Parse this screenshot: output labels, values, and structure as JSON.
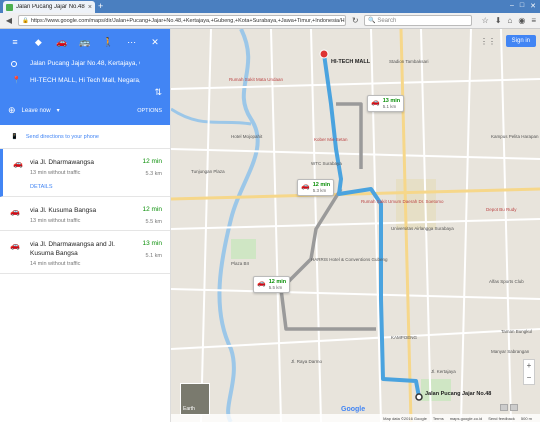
{
  "browser": {
    "tab_title": "Jalan Pucang Jajar No.48 to...",
    "url": "https://www.google.com/maps/dir/Jalan+Pucang+Jajar+No.48,+Kertajaya,+Gubeng,+Kota+Surabaya,+Jawa+Timur,+Indonesia/Hi-Te",
    "search_placeholder": "Search"
  },
  "panel": {
    "origin": "Jalan Pucang Jajar No.48, Kertajaya, G...",
    "destination": "HI-TECH MALL, Hi Tech Mall, Negara, K...",
    "leave_now": "Leave now",
    "options": "OPTIONS",
    "send_directions": "Send directions to your phone",
    "routes": [
      {
        "name": "via Jl. Dharmawangsa",
        "sub": "13 min without traffic",
        "time": "12 min",
        "dist": "5.3 km",
        "details": "DETAILS"
      },
      {
        "name": "via Jl. Kusuma Bangsa",
        "sub": "13 min without traffic",
        "time": "12 min",
        "dist": "5.5 km"
      },
      {
        "name": "via Jl. Dharmawangsa and Jl. Kusuma Bangsa",
        "sub": "14 min without traffic",
        "time": "13 min",
        "dist": "5.1 km"
      }
    ]
  },
  "map": {
    "sign_in": "Sign in",
    "destination_label": "HI-TECH MALL",
    "origin_label": "Jalan Pucang Jajar No.48",
    "bubbles": [
      {
        "time": "13 min",
        "dist": "5.1 km"
      },
      {
        "time": "12 min",
        "dist": "5.3 km"
      },
      {
        "time": "12 min",
        "dist": "5.5 km"
      }
    ],
    "earth_label": "Earth",
    "google": "Google",
    "footer": {
      "data": "Map data ©2016 Google",
      "terms": "Terms",
      "domain": "maps.google.co.id",
      "feedback": "Send feedback",
      "scale": "500 m"
    },
    "labels": [
      "Stadion Tambaksari",
      "Rumah Sakit Mata Undaan",
      "Kober Mie Setan",
      "Hotel Mojopahit",
      "Tunjungan Plaza",
      "WTC Surabaya",
      "Rumah Sakit Umum Daerah Dr. Soetomo",
      "Universitas Airlangga Surabaya",
      "HARRIS Hotel & Conventions Gubeng",
      "Plaza BII",
      "Alfas Sports Club",
      "Kampus Pelita Harapan",
      "Depot Bu Rudy",
      "Taman Bungkul",
      "Manyar Sabrangan",
      "KAMPOENG",
      "Jl. Kertajaya",
      "Jl. Raya Darmo"
    ]
  },
  "colors": {
    "header_blue": "#4285f4",
    "route_blue": "#4aa3df",
    "route_gray": "#9a9a9a",
    "time_green": "#0a8f08"
  }
}
